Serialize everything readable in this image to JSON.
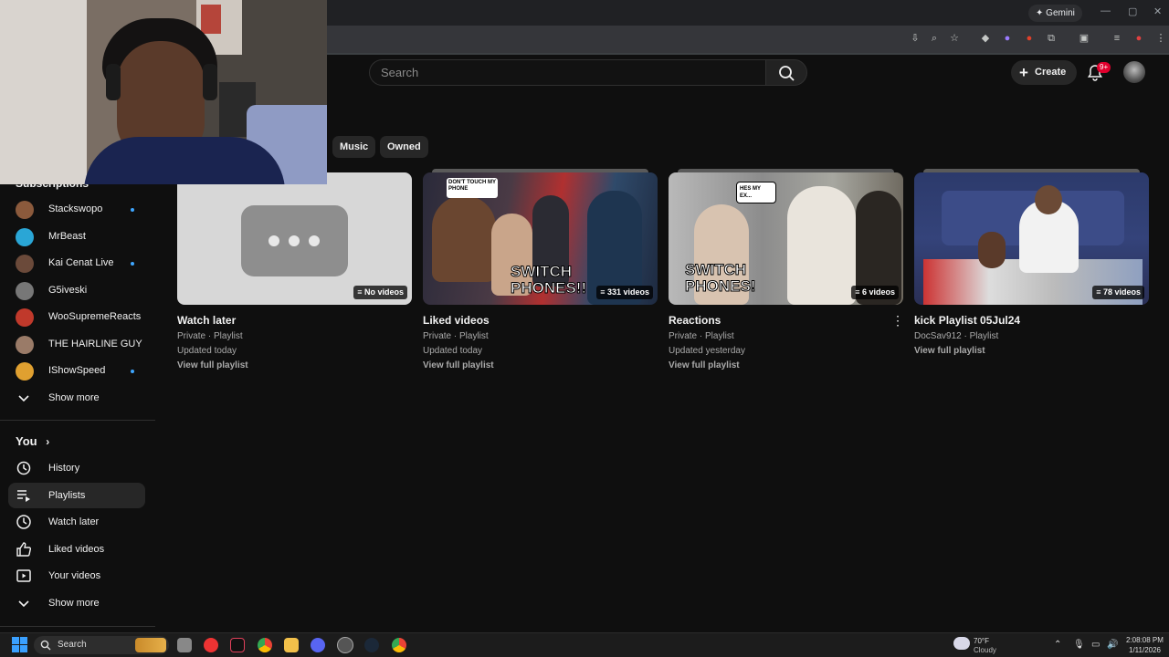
{
  "browser": {
    "gemini_label": "Gemini",
    "window_controls": [
      "—",
      "▢",
      "✕"
    ]
  },
  "youtube": {
    "search_placeholder": "Search",
    "create_label": "Create",
    "notif_badge": "9+"
  },
  "chips": [
    {
      "label": "Music"
    },
    {
      "label": "Owned"
    }
  ],
  "sidebar": {
    "subscriptions_heading": "Subscriptions",
    "subscriptions": [
      {
        "name": "Stackswopo",
        "live": true,
        "color": "#8b5a3c"
      },
      {
        "name": "MrBeast",
        "live": false,
        "color": "#2aa6d6"
      },
      {
        "name": "Kai Cenat Live",
        "live": true,
        "color": "#6b4a3a"
      },
      {
        "name": "G5iveski",
        "live": false,
        "color": "#777777"
      },
      {
        "name": "WooSupremeReacts",
        "live": false,
        "color": "#c0392b"
      },
      {
        "name": "THE HAIRLINE GUY",
        "live": false,
        "color": "#9a7b68"
      },
      {
        "name": "IShowSpeed",
        "live": true,
        "color": "#e0a030"
      }
    ],
    "show_more_subs": "Show more",
    "you_heading": "You",
    "you_items": [
      {
        "label": "History",
        "icon": "history-icon",
        "selected": false
      },
      {
        "label": "Playlists",
        "icon": "playlists-icon",
        "selected": true
      },
      {
        "label": "Watch later",
        "icon": "clock-icon",
        "selected": false
      },
      {
        "label": "Liked videos",
        "icon": "thumbs-up-icon",
        "selected": false
      },
      {
        "label": "Your videos",
        "icon": "video-icon",
        "selected": false
      }
    ],
    "show_more_you": "Show more"
  },
  "playlists": [
    {
      "title": "Watch later",
      "count": "No videos",
      "line1": "Private · Playlist",
      "line2": "Updated today",
      "link": "View full playlist"
    },
    {
      "title": "Liked videos",
      "count": "331 videos",
      "line1": "Private · Playlist",
      "line2": "Updated today",
      "link": "View full playlist"
    },
    {
      "title": "Reactions",
      "count": "6 videos",
      "line1": "Private · Playlist",
      "line2": "Updated yesterday",
      "link": "View full playlist"
    },
    {
      "title": "kick Playlist 05Jul24",
      "count": "78 videos",
      "line1": "DocSav912 · Playlist",
      "line2": "",
      "link": "View full playlist"
    }
  ],
  "thumb_text": {
    "liked_bubble": "DON'T TOUCH MY PHONE",
    "liked_caption": "SWITCH PHONES!!",
    "reactions_bubble": "HES MY EX...",
    "reactions_caption": "SWITCH PHONES!"
  },
  "taskbar": {
    "search_label": "Search",
    "weather_temp": "70°F",
    "weather_desc": "Cloudy",
    "time": "2:08:08 PM",
    "date": "1/11/2026"
  }
}
